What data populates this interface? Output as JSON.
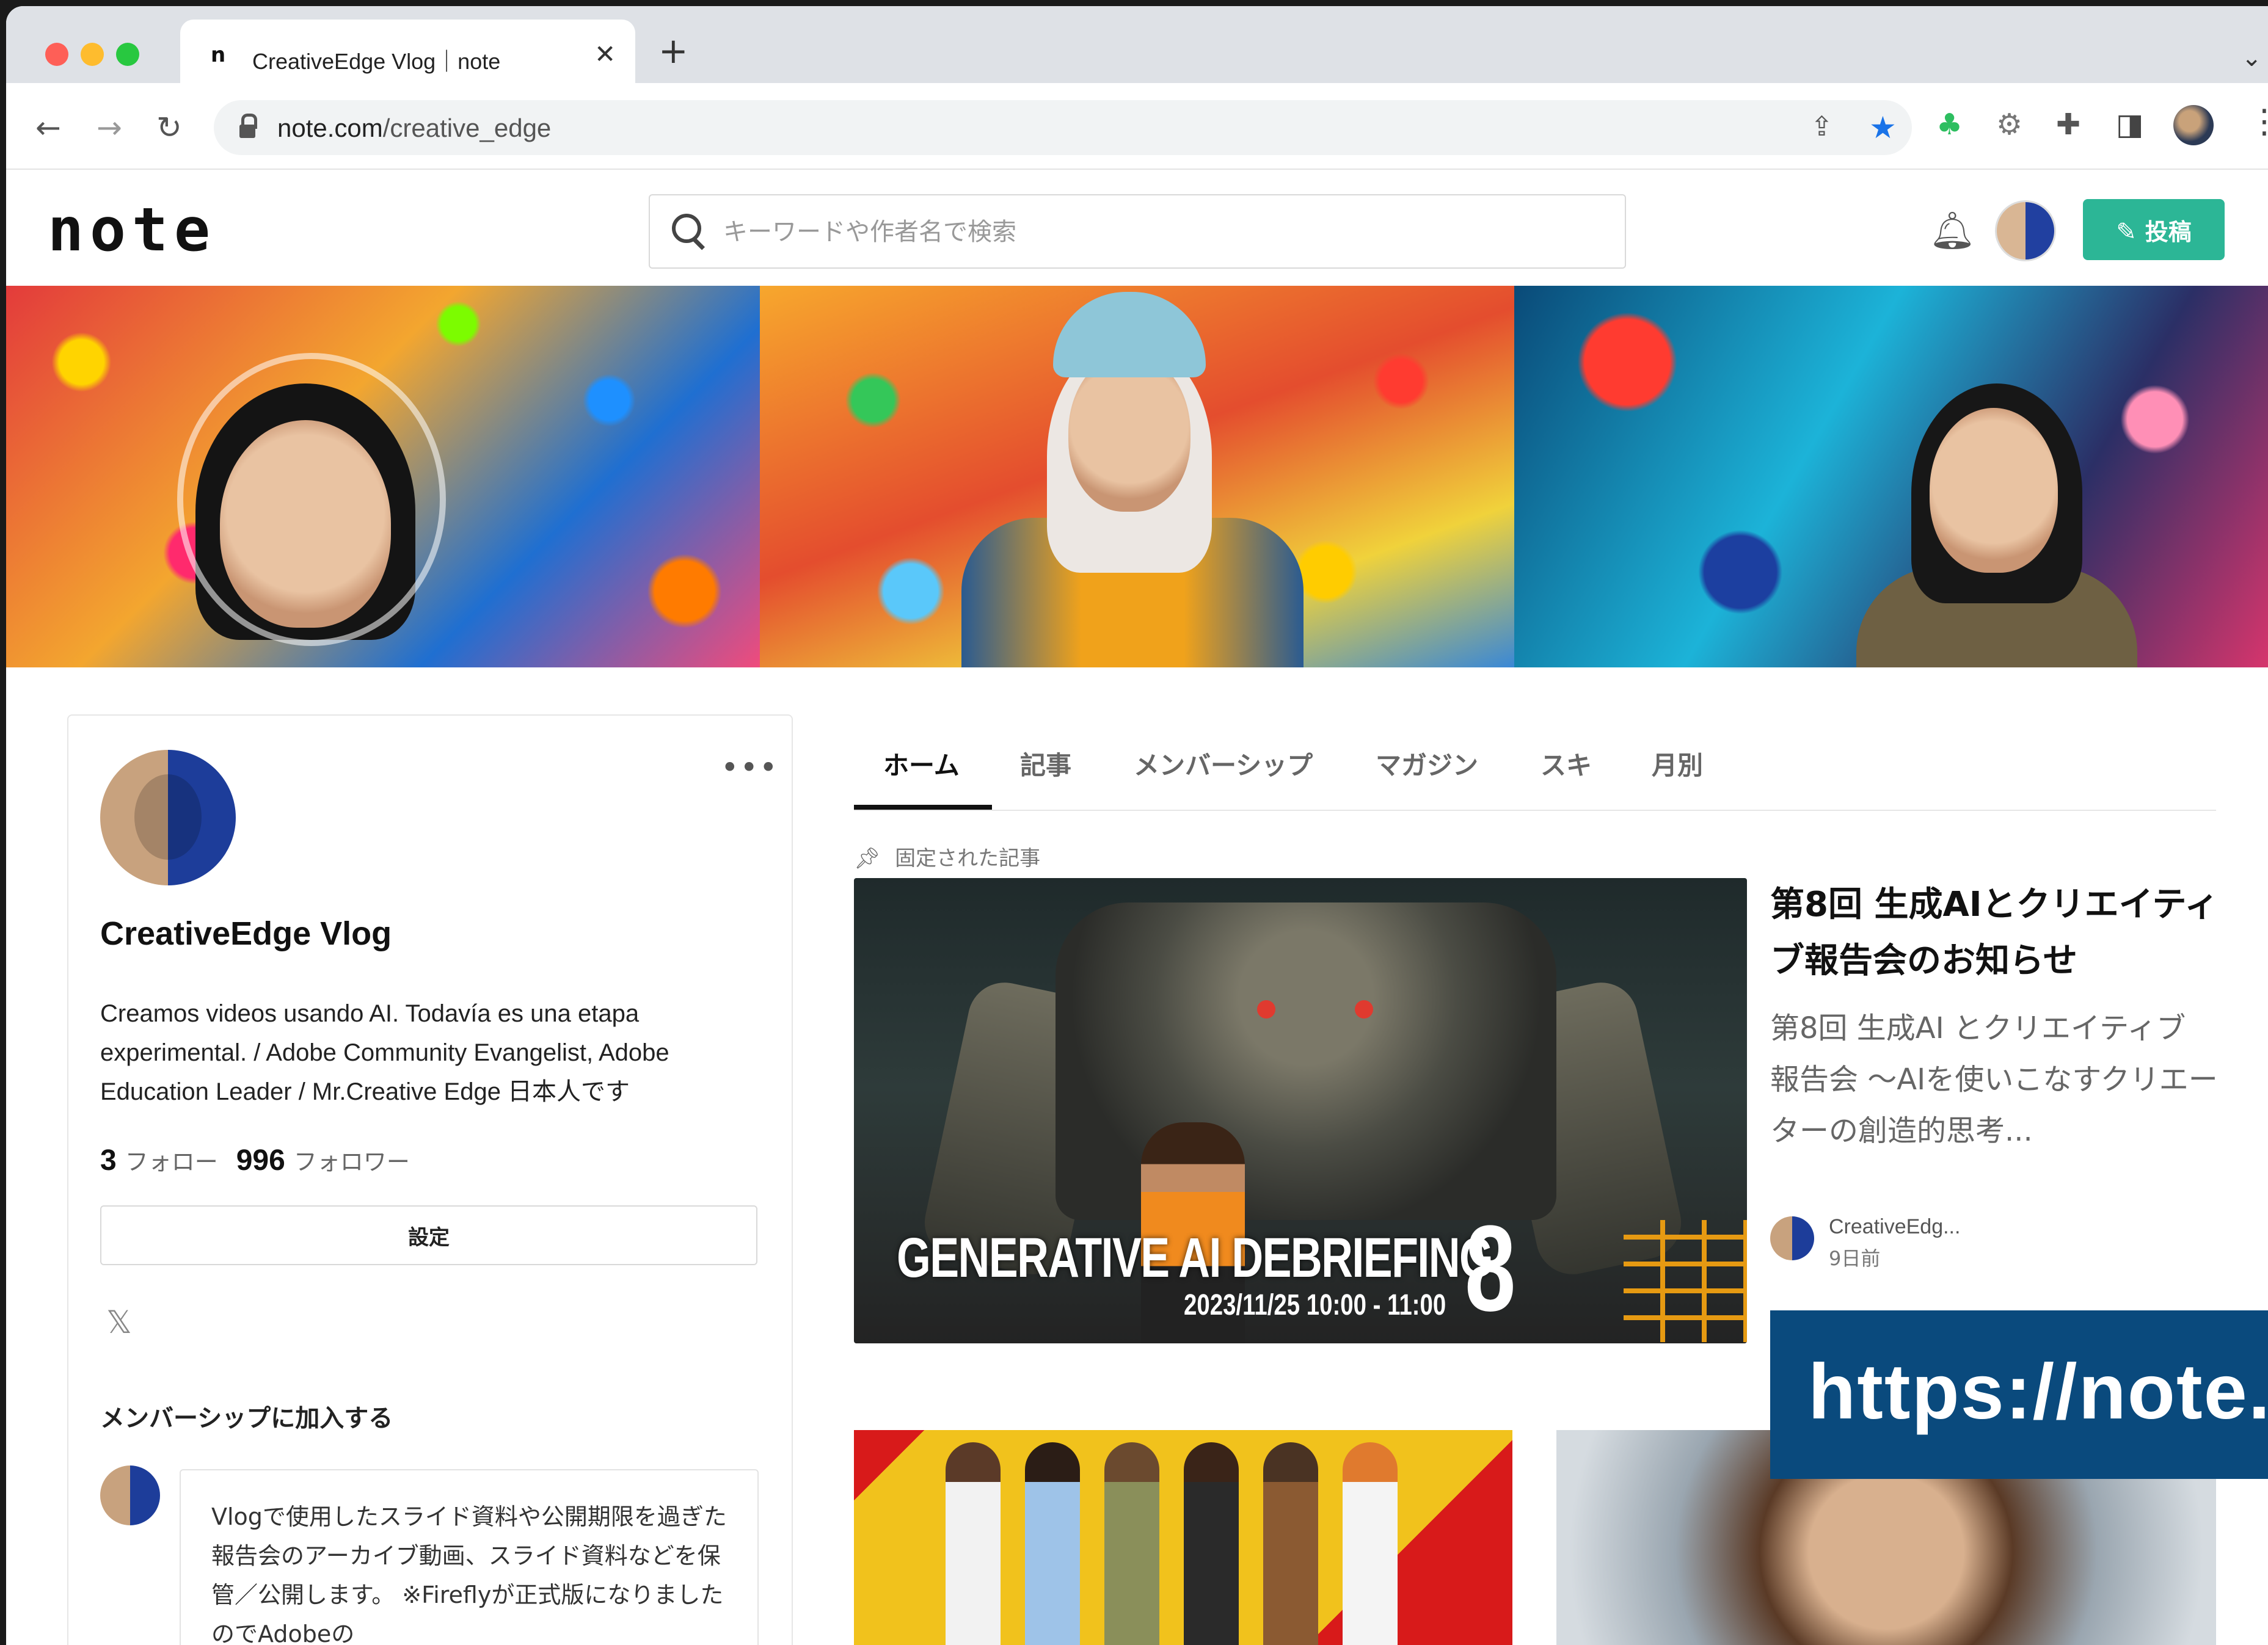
{
  "browser": {
    "tab": {
      "favicon": "n",
      "title": "CreativeEdge Vlog｜note",
      "close": "✕"
    },
    "new_tab": "+",
    "url_host": "note.com",
    "url_path": "/creative_edge"
  },
  "header": {
    "logo": "note",
    "search_placeholder": "キーワードや作者名で検索",
    "post_button": "投稿"
  },
  "profile": {
    "name": "CreativeEdge Vlog",
    "bio": "Creamos videos usando AI. Todavía es una etapa experimental. / Adobe Community Evangelist, Adobe Education Leader / Mr.Creative Edge 日本人です",
    "following_count": "3",
    "following_label": "フォロー",
    "followers_count": "996",
    "followers_label": "フォロワー",
    "settings_button": "設定",
    "x_icon": "𝕏",
    "membership_heading": "メンバーシップに加入する",
    "membership_text": "Vlogで使用したスライド資料や公開期限を過ぎた報告会のアーカイブ動画、スライド資料などを保管／公開します。 ※Fireflyが正式版になりましたのでAdobeの"
  },
  "tabs": [
    "ホーム",
    "記事",
    "メンバーシップ",
    "マガジン",
    "スキ",
    "月別"
  ],
  "pinned": {
    "label": "固定された記事",
    "image_title": "GENERATIVE AI DEBRIEFING",
    "image_number": "8",
    "image_date": "2023/11/25 10:00 - 11:00",
    "title": "第8回 生成AIとクリエイティブ報告会のお知らせ",
    "excerpt": "第8回 生成AI とクリエイティブ 報告会 ～AIを使いこなすクリエーターの創造的思考...",
    "author": "CreativeEdg...",
    "date": "9日前"
  },
  "overlay_text": "https://note."
}
